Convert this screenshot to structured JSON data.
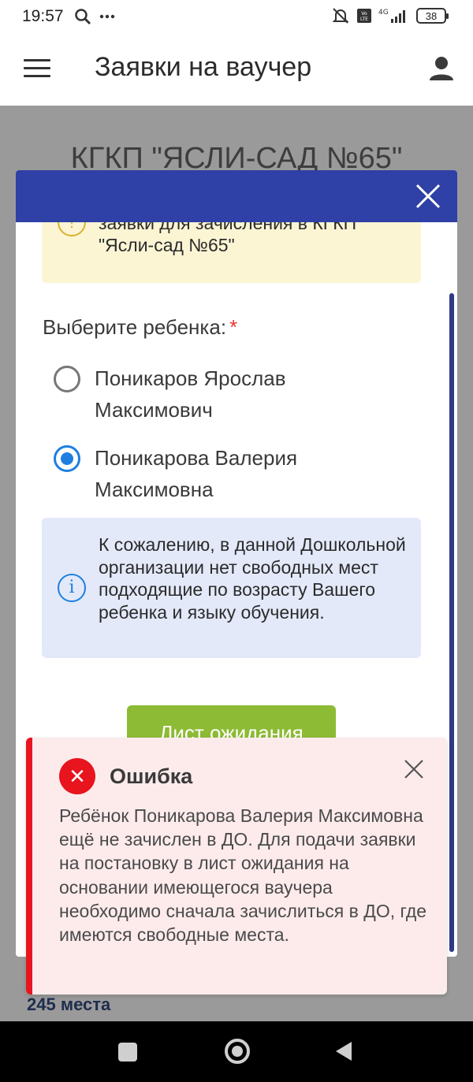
{
  "status_bar": {
    "time": "19:57",
    "battery": "38"
  },
  "app_bar": {
    "title": "Заявки на ваучер"
  },
  "background": {
    "heading": "КГКП \"ЯСЛИ-САД №65\"",
    "places": "245 места"
  },
  "modal": {
    "warning_text": "заявки для зачисления в КГКП \"Ясли-сад №65\"",
    "child_label": "Выберите ребенка:",
    "required_mark": "*",
    "children": [
      {
        "name": "Поникаров Ярослав Максимович",
        "selected": false
      },
      {
        "name": "Поникарова Валерия Максимовна",
        "selected": true
      }
    ],
    "info_text": "К сожалению, в данной Дошкольной организации нет свободных мест подходящие по возрасту Вашего ребенка и языку обучения.",
    "waitlist_button": "Лист ожидания"
  },
  "toast": {
    "title": "Ошибка",
    "message": "Ребёнок Поникарова Валерия Максимовна ещё не зачислен в ДО. Для подачи заявки на постановку в лист ожидания на основании имеющегося ваучера необходимо сначала зачислиться в ДО, где имеются свободные места.",
    "icon": "error-x-icon"
  },
  "colors": {
    "modal_header": "#2f40a6",
    "radio_selected": "#1e7fe0",
    "waitlist_button": "#8dbb35",
    "error": "#e8141e"
  }
}
